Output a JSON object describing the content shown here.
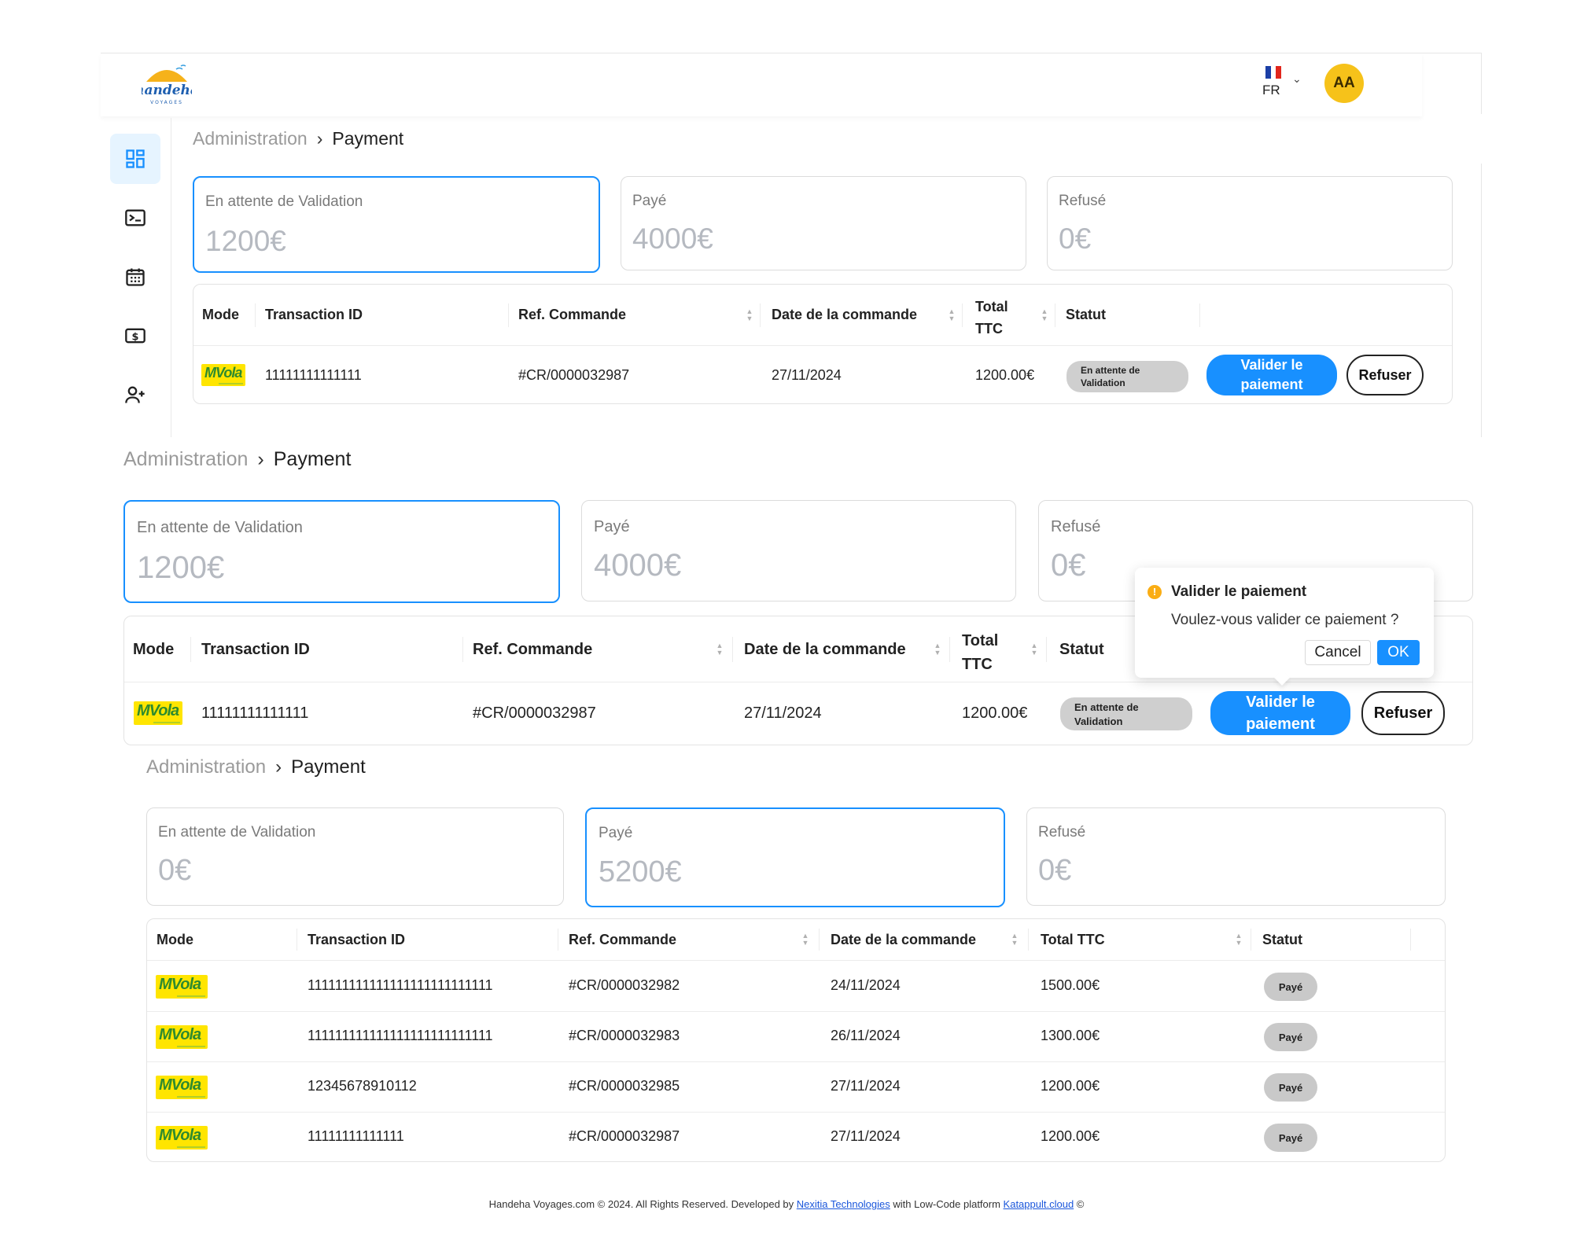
{
  "brand": {
    "logo_text": "handeha",
    "logo_sub": "VOYAGES"
  },
  "header": {
    "language": "FR",
    "avatar_initials": "AA"
  },
  "breadcrumb": {
    "parent": "Administration",
    "current": "Payment",
    "separator": "›"
  },
  "cards": {
    "pending_label": "En attente de Validation",
    "paid_label": "Payé",
    "refused_label": "Refusé"
  },
  "panel1": {
    "pending_value": "1200€",
    "paid_value": "4000€",
    "refused_value": "0€"
  },
  "panel2": {
    "pending_value": "1200€",
    "paid_value": "4000€",
    "refused_value": "0€"
  },
  "panel3": {
    "pending_value": "0€",
    "paid_value": "5200€",
    "refused_value": "0€"
  },
  "table_headers": {
    "mode": "Mode",
    "transaction_id": "Transaction ID",
    "ref": "Ref. Commande",
    "date": "Date de la commande",
    "total_l1": "Total",
    "total_l2": "TTC",
    "total": "Total TTC",
    "status": "Statut"
  },
  "pending_row": {
    "mode_logo": "MVola",
    "transaction_id": "11111111111111",
    "ref": "#CR/0000032987",
    "date": "27/11/2024",
    "total": "1200.00€",
    "status_l1": "En attente de",
    "status_l2": "Validation",
    "validate_l1": "Valider le",
    "validate_l2": "paiement",
    "refuse": "Refuser"
  },
  "popconfirm": {
    "title": "Valider le paiement",
    "description": "Voulez-vous valider ce paiement ?",
    "cancel": "Cancel",
    "ok": "OK",
    "warn_icon": "!"
  },
  "paid_rows": [
    {
      "mode_logo": "MVola",
      "transaction_id": "111111111111111111111111111",
      "ref": "#CR/0000032982",
      "date": "24/11/2024",
      "total": "1500.00€",
      "status": "Payé"
    },
    {
      "mode_logo": "MVola",
      "transaction_id": "111111111111111111111111111",
      "ref": "#CR/0000032983",
      "date": "26/11/2024",
      "total": "1300.00€",
      "status": "Payé"
    },
    {
      "mode_logo": "MVola",
      "transaction_id": "12345678910112",
      "ref": "#CR/0000032985",
      "date": "27/11/2024",
      "total": "1200.00€",
      "status": "Payé"
    },
    {
      "mode_logo": "MVola",
      "transaction_id": "11111111111111",
      "ref": "#CR/0000032987",
      "date": "27/11/2024",
      "total": "1200.00€",
      "status": "Payé"
    }
  ],
  "footer": {
    "prefix": "Handeha Voyages.com © 2024. All Rights Reserved. Developed by ",
    "company": "Nexitia Technologies",
    "middle": " with Low-Code platform ",
    "platform": "Katappult.cloud",
    "suffix": " ©"
  },
  "colors": {
    "accent": "#1890ff",
    "avatar": "#f6c21a",
    "mvola": "#ffe500"
  }
}
